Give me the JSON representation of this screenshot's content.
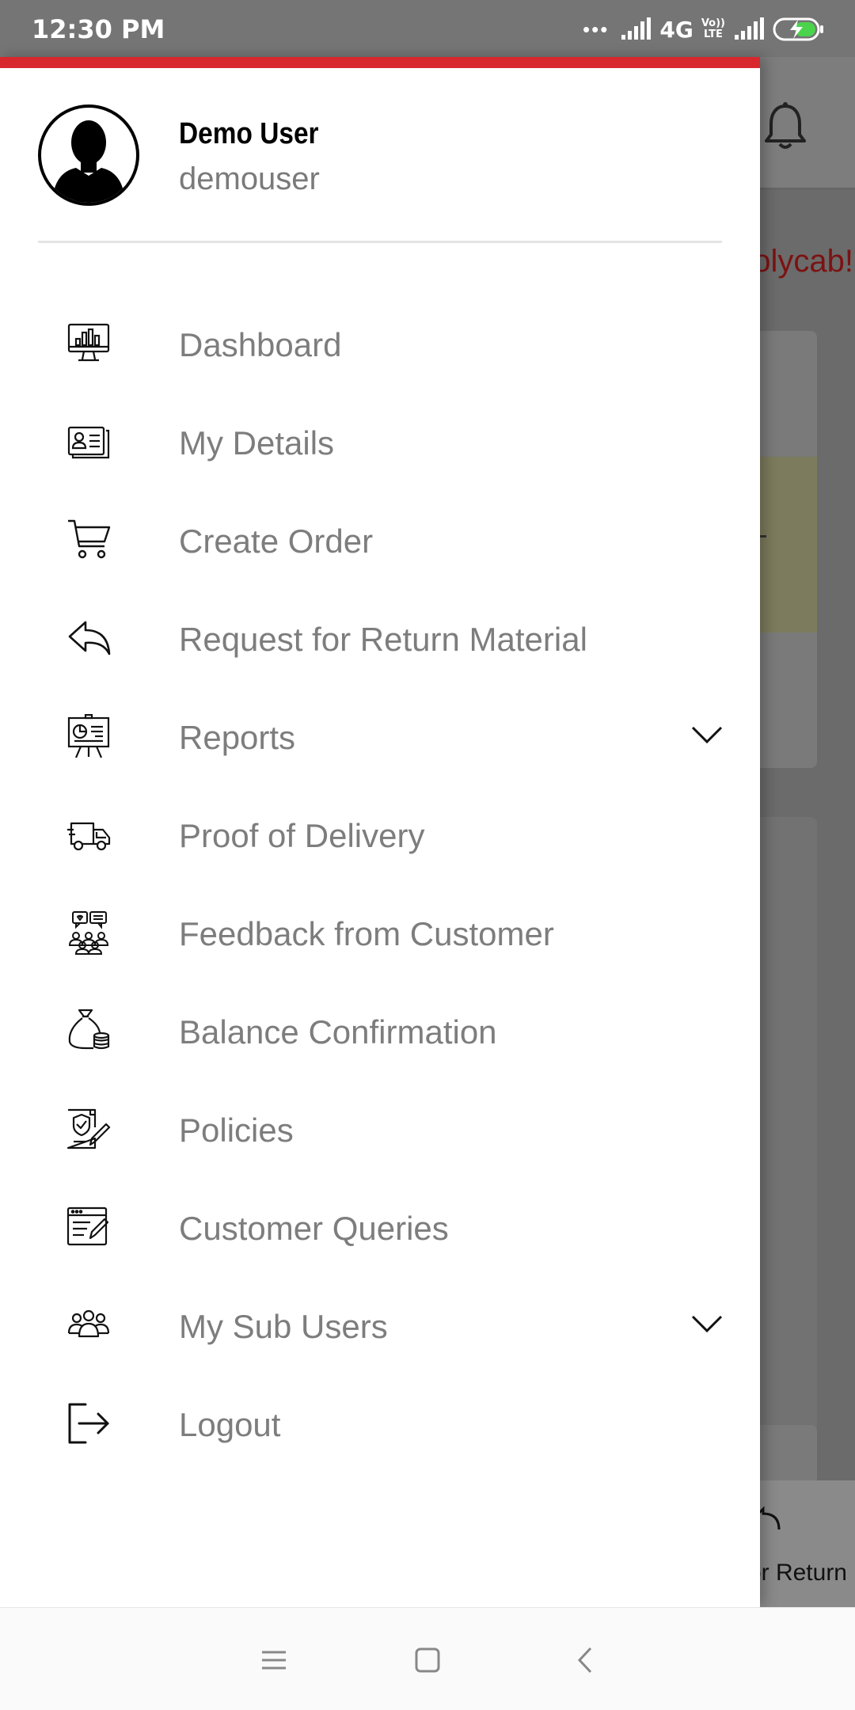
{
  "status_bar": {
    "time": "12:30 PM",
    "dots": "•••",
    "network": "4G",
    "volte_top": "Vo))",
    "volte_bottom": "LTE"
  },
  "background": {
    "welcome_fragment": "olycab!",
    "bottom_tab_fragment": "or Return"
  },
  "drawer": {
    "accent_color": "#d9272e",
    "user": {
      "name": "Demo User",
      "handle": "demouser"
    },
    "menu": [
      {
        "label": "Dashboard",
        "icon": "dashboard-monitor-icon"
      },
      {
        "label": "My Details",
        "icon": "id-card-icon"
      },
      {
        "label": "Create Order",
        "icon": "cart-icon"
      },
      {
        "label": "Request for Return Material",
        "icon": "reply-arrow-icon"
      },
      {
        "label": "Reports",
        "icon": "presentation-board-icon",
        "expandable": true
      },
      {
        "label": "Proof of Delivery",
        "icon": "delivery-van-icon"
      },
      {
        "label": "Feedback from Customer",
        "icon": "customer-feedback-icon"
      },
      {
        "label": "Balance Confirmation",
        "icon": "money-bag-icon"
      },
      {
        "label": "Policies",
        "icon": "policy-document-icon"
      },
      {
        "label": "Customer Queries",
        "icon": "query-form-icon"
      },
      {
        "label": "My Sub Users",
        "icon": "users-group-icon",
        "expandable": true
      },
      {
        "label": "Logout",
        "icon": "logout-icon"
      }
    ]
  },
  "nav_bar": {
    "buttons": [
      "menu-icon",
      "home-square-icon",
      "back-chevron-icon"
    ]
  }
}
